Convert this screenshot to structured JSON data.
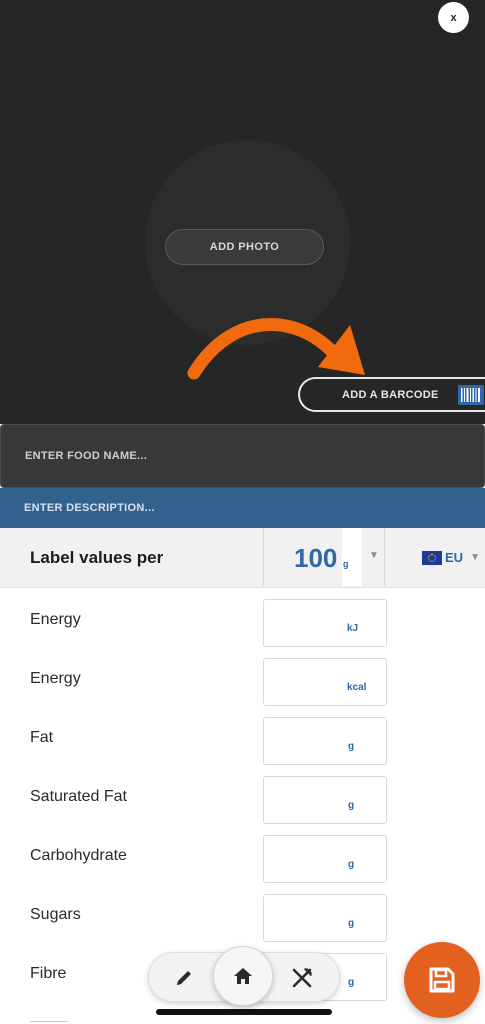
{
  "photo": {
    "close_label": "x",
    "add_photo_label": "ADD PHOTO",
    "add_barcode_label": "ADD A BARCODE"
  },
  "food": {
    "name_placeholder": "ENTER FOOD NAME...",
    "description_placeholder": "ENTER DESCRIPTION..."
  },
  "label_values": {
    "title": "Label values per",
    "amount": "100",
    "unit": "g",
    "region": "EU"
  },
  "nutrients": [
    {
      "label": "Energy",
      "unit": "kJ"
    },
    {
      "label": "Energy",
      "unit": "kcal"
    },
    {
      "label": "Fat",
      "unit": "g"
    },
    {
      "label": "Saturated Fat",
      "unit": "g"
    },
    {
      "label": "Carbohydrate",
      "unit": "g"
    },
    {
      "label": "Sugars",
      "unit": "g"
    },
    {
      "label": "Fibre",
      "unit": "g"
    }
  ],
  "toolbar": {
    "edit_icon": "pencil-icon",
    "home_icon": "home-icon",
    "food_icon": "fork-knife-icon",
    "save_icon": "floppy-disk-icon"
  },
  "colors": {
    "accent_blue": "#2f67a8",
    "description_bar": "#33618d",
    "save_orange": "#e2611f",
    "arrow_orange": "#f06a0f",
    "dark_background": "#262626"
  }
}
